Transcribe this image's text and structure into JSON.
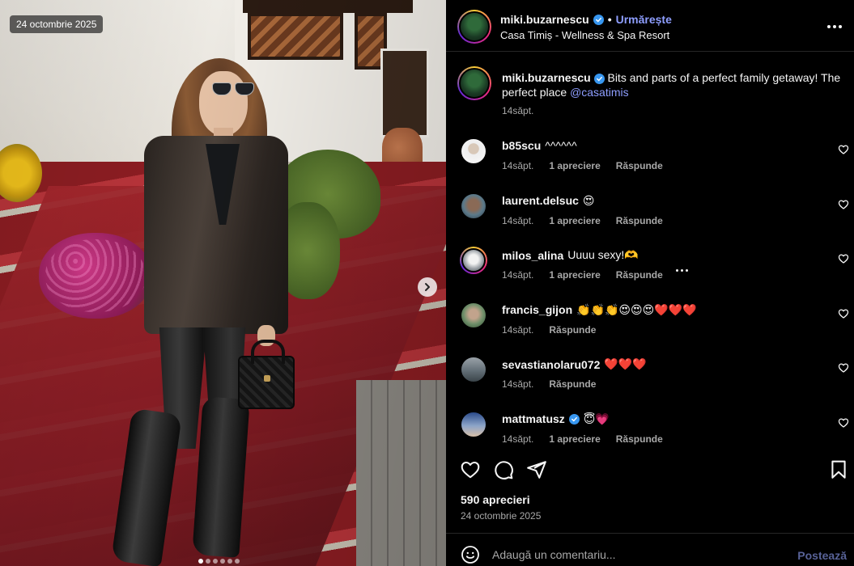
{
  "photo": {
    "date_badge": "24 octombrie 2025",
    "carousel": {
      "count": 6,
      "active_index": 0
    }
  },
  "header": {
    "username": "miki.buzarnescu",
    "separator": "•",
    "follow_label": "Urmărește",
    "location": "Casa Timiș - Wellness & Spa Resort"
  },
  "caption": {
    "username": "miki.buzarnescu",
    "text": "Bits and parts of a perfect family getaway! The perfect place",
    "mention": "@casatimis",
    "time": "14săpt."
  },
  "comments": [
    {
      "username": "b85scu",
      "text": "^^^^^^",
      "time": "14săpt.",
      "likes": "1 apreciere",
      "reply": "Răspunde",
      "verified": false
    },
    {
      "username": "laurent.delsuc",
      "text": "😍",
      "time": "14săpt.",
      "likes": "1 apreciere",
      "reply": "Răspunde",
      "verified": false
    },
    {
      "username": "milos_alina",
      "text": "Uuuu sexy!🫶",
      "time": "14săpt.",
      "likes": "1 apreciere",
      "reply": "Răspunde",
      "verified": false
    },
    {
      "username": "francis_gijon",
      "text": "👏👏👏😍😍😍❤️❤️❤️",
      "time": "14săpt.",
      "likes": "",
      "reply": "Răspunde",
      "verified": false
    },
    {
      "username": "sevastianolaru072",
      "text": "❤️❤️❤️",
      "time": "14săpt.",
      "likes": "",
      "reply": "Răspunde",
      "verified": false
    },
    {
      "username": "mattmatusz",
      "text": "😇💗",
      "time": "14săpt.",
      "likes": "1 apreciere",
      "reply": "Răspunde",
      "verified": true
    }
  ],
  "post": {
    "likes": "590 aprecieri",
    "date": "24 octombrie 2025"
  },
  "add_comment": {
    "placeholder": "Adaugă un comentariu...",
    "post_label": "Postează"
  },
  "icons": {
    "like": "heart-icon",
    "comment": "comment-bubble-icon",
    "share": "paper-plane-icon",
    "save": "bookmark-icon",
    "emoji": "smiley-icon",
    "more": "ellipsis-icon",
    "verified": "verified-badge-icon",
    "next": "chevron-right-icon"
  },
  "colors": {
    "background": "#000000",
    "link": "#8e9eff",
    "muted": "#a8a8a8",
    "verified": "#3897f0"
  }
}
